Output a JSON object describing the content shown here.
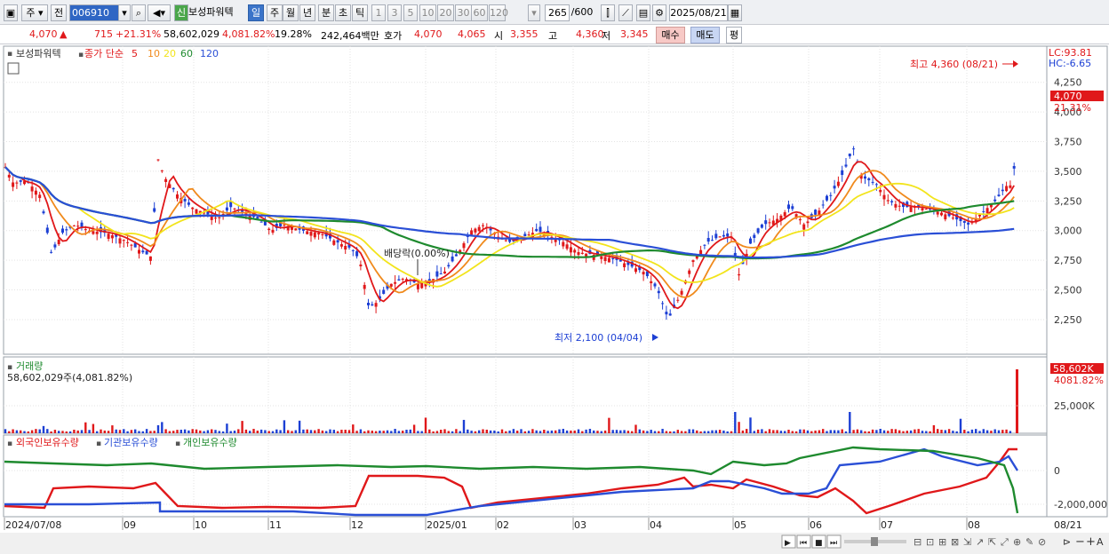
{
  "toolbar": {
    "market_type": "주",
    "period_type": "전",
    "stock_code": "006910",
    "stock_name": "보성파워텍",
    "new_badge": "신",
    "periods": [
      "일",
      "주",
      "월",
      "년",
      "분",
      "초",
      "틱"
    ],
    "active_period": "일",
    "intervals": [
      "1",
      "3",
      "5",
      "10",
      "20",
      "30",
      "60",
      "120"
    ],
    "count_current": "265",
    "count_total": "/600",
    "date": "2025/08/21"
  },
  "price_bar": {
    "price": "4,070",
    "change_arrow": "▲",
    "change": "715",
    "change_pct": "+21.31%",
    "volume": "58,602,029",
    "volume_pct": "4,081.82%",
    "turnover_pct": "19.28%",
    "trade_value": "242,464백만",
    "quote_label": "호가",
    "ask": "4,070",
    "bid": "4,065",
    "open_label": "시",
    "open": "3,355",
    "high_label": "고",
    "high": "4,360",
    "low_label": "저",
    "low": "3,345",
    "buy_label": "매수",
    "sell_label": "매도",
    "flat_label": "평"
  },
  "price_panel": {
    "legend_name": "보성파워텍",
    "legend_close": "종가 단순",
    "ma_labels": [
      "5",
      "10",
      "20",
      "60",
      "120"
    ],
    "ma_colors": [
      "#e0181a",
      "#f08a1c",
      "#f2e41c",
      "#1e8a2e",
      "#2a4fd6"
    ],
    "lc": "LC:93.81",
    "hc": "HC:-6.65",
    "current_price_tag": "4,070",
    "current_pct_tag": "21.31%",
    "high_annotation": "최고 4,360 (08/21)",
    "low_annotation": "최저 2,100 (04/04)",
    "dividend_annotation": "배당락(0.00%)",
    "y_ticks": [
      "4,250",
      "4,000",
      "3,750",
      "3,500",
      "3,250",
      "3,000",
      "2,750",
      "2,500",
      "2,250"
    ]
  },
  "volume_panel": {
    "label": "거래량",
    "value": "58,602,029주(4,081.82%)",
    "tag_value": "58,602K",
    "tag_pct": "4081.82%",
    "y_tick": "25,000K"
  },
  "holdings_panel": {
    "legend": [
      "외국인보유수량",
      "기관보유수량",
      "개인보유수량"
    ],
    "colors": [
      "#e0181a",
      "#2a4fd6",
      "#1e8a2e"
    ],
    "y_ticks": [
      "0",
      "-2,000,000"
    ]
  },
  "x_axis": {
    "labels": [
      "2024/07/08",
      "09",
      "10",
      "11",
      "12",
      "2025/01",
      "02",
      "03",
      "04",
      "05",
      "06",
      "07",
      "08"
    ],
    "end_label": "08/21"
  },
  "chart_data": {
    "type": "candlestick",
    "series": [
      {
        "name": "종가",
        "x": [
          "2024/07/08",
          "2024/09",
          "2024/10",
          "2024/11",
          "2024/12",
          "2025/01",
          "2025/02",
          "2025/03",
          "2025/04",
          "2025/05",
          "2025/06",
          "2025/07",
          "2025/08",
          "2025/08/21"
        ],
        "values": [
          3600,
          2950,
          3250,
          3100,
          2450,
          2550,
          3000,
          2800,
          2400,
          2850,
          3050,
          3450,
          3150,
          4070
        ]
      }
    ],
    "price_ylim": [
      2100,
      4360
    ],
    "highest": {
      "date": "08/21",
      "value": 4360
    },
    "lowest": {
      "date": "04/04",
      "value": 2100
    },
    "last_close": 4070
  }
}
